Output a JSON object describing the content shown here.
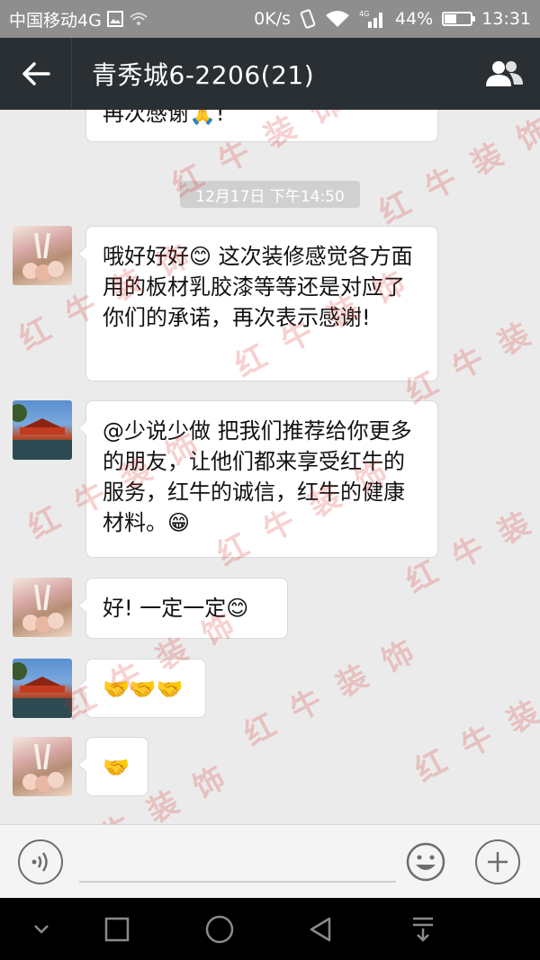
{
  "status_bar": {
    "carrier": "中国移动4G",
    "speed": "0K/s",
    "network": "4G",
    "battery_percent": "44%",
    "battery_level": 0.44,
    "time": "13:31"
  },
  "header": {
    "title": "青秀城6-2206(21)",
    "back_icon": "back-arrow-icon",
    "contacts_icon": "group-members-icon"
  },
  "messages": [
    {
      "type": "text",
      "text": "再次感谢🙏!"
    },
    {
      "type": "timestamp",
      "text": "12月17日 下午14:50"
    },
    {
      "type": "text",
      "text": "哦好好好😊 这次装修感觉各方面用的板材乳胶漆等等还是对应了你们的承诺，再次表示感谢!"
    },
    {
      "type": "text",
      "text": "@少说少做 把我们推荐给你更多的朋友，让他们都来享受红牛的服务，红牛的诚信，红牛的健康材料。😁"
    },
    {
      "type": "text",
      "text": "好! 一定一定😊"
    },
    {
      "type": "emoji",
      "text": "🤝🤝🤝"
    },
    {
      "type": "emoji",
      "text": "🤝"
    }
  ],
  "watermark": "红 牛 装 饰",
  "input": {
    "placeholder": "",
    "value": ""
  },
  "colors": {
    "status_bg": "#8e8e8e",
    "header_bg": "#2a2f33",
    "chat_bg": "#ebebeb",
    "bubble_bg": "#ffffff",
    "watermark": "#dc2828"
  }
}
